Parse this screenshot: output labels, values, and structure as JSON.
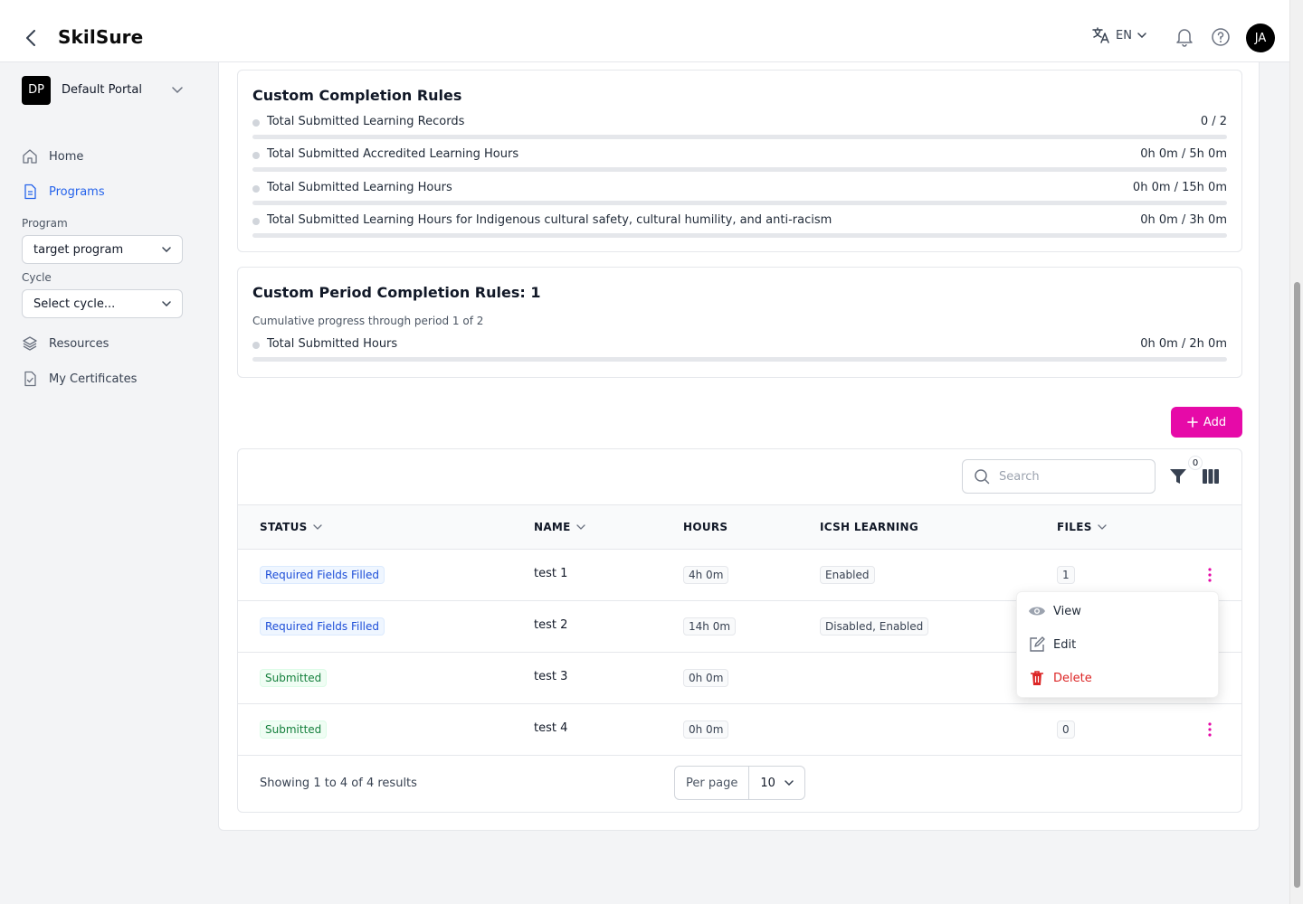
{
  "header": {
    "app_title": "SkilSure",
    "language": "EN",
    "avatar_initials": "JA"
  },
  "sidebar": {
    "portal_initials": "DP",
    "portal_name": "Default Portal",
    "nav_home": "Home",
    "nav_programs": "Programs",
    "program_label": "Program",
    "program_value": "target program",
    "cycle_label": "Cycle",
    "cycle_value": "Select cycle...",
    "nav_resources": "Resources",
    "nav_certificates": "My Certificates"
  },
  "custom_rules": {
    "title": "Custom Completion Rules",
    "rules": [
      {
        "label": "Total Submitted Learning Records",
        "value": "0 / 2",
        "progress": 0
      },
      {
        "label": "Total Submitted Accredited Learning Hours",
        "value": "0h 0m / 5h 0m",
        "progress": 0
      },
      {
        "label": "Total Submitted Learning Hours",
        "value": "0h 0m / 15h 0m",
        "progress": 0
      },
      {
        "label": "Total Submitted Learning Hours for Indigenous cultural safety, cultural humility, and anti-racism",
        "value": "0h 0m / 3h 0m",
        "progress": 0
      }
    ]
  },
  "period_rules": {
    "title": "Custom Period Completion Rules: 1",
    "subtitle": "Cumulative progress through period 1 of 2",
    "rules": [
      {
        "label": "Total Submitted Hours",
        "value": "0h 0m / 2h 0m",
        "progress": 0
      }
    ]
  },
  "actions": {
    "add_label": "Add"
  },
  "table": {
    "search_placeholder": "Search",
    "filter_count": "0",
    "columns": {
      "status": "STATUS",
      "name": "NAME",
      "hours": "HOURS",
      "icsh": "ICSH LEARNING",
      "files": "FILES"
    },
    "rows": [
      {
        "status": "Required Fields Filled",
        "name": "test 1",
        "hours": "4h 0m",
        "icsh": "Enabled",
        "files": "1"
      },
      {
        "status": "Required Fields Filled",
        "name": "test 2",
        "hours": "14h 0m",
        "icsh": "Disabled, Enabled",
        "files": ""
      },
      {
        "status": "Submitted",
        "name": "test 3",
        "hours": "0h 0m",
        "icsh": "",
        "files": ""
      },
      {
        "status": "Submitted",
        "name": "test 4",
        "hours": "0h 0m",
        "icsh": "",
        "files": "0"
      }
    ],
    "footer_text": "Showing 1 to 4 of 4 results",
    "per_page_label": "Per page",
    "per_page_value": "10"
  },
  "row_menu": {
    "view": "View",
    "edit": "Edit",
    "delete": "Delete"
  },
  "colors": {
    "accent": "#e60aa8",
    "link_active": "#2563eb",
    "danger": "#dc2626"
  }
}
